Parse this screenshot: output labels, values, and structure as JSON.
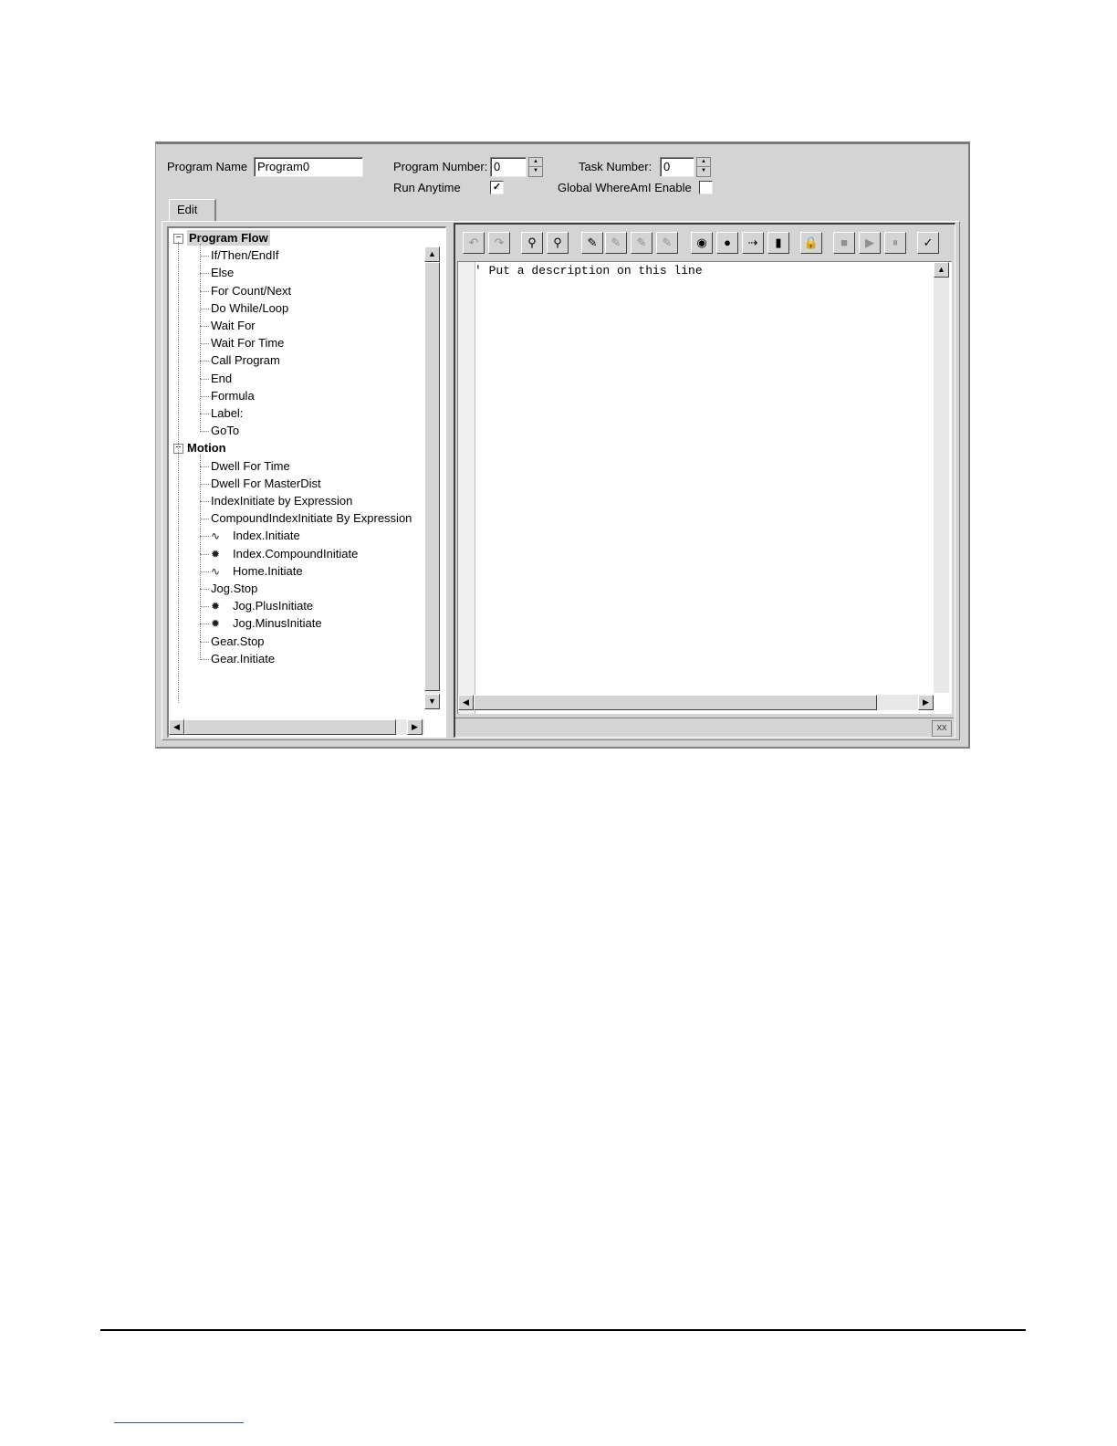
{
  "header": {
    "program_name_label": "Program Name",
    "program_name_value": "Program0",
    "program_number_label": "Program Number:",
    "program_number_value": "0",
    "task_number_label": "Task Number:",
    "task_number_value": "0",
    "run_anytime_label": "Run Anytime",
    "run_anytime_checked": true,
    "global_whereami_label": "Global WhereAmI Enable",
    "global_whereami_checked": false
  },
  "tabs": {
    "edit_label": "Edit"
  },
  "tree": {
    "groups": [
      {
        "label": "Program Flow",
        "expander": "⊟",
        "items": [
          "If/Then/EndIf",
          "Else",
          "For Count/Next",
          "Do While/Loop",
          "Wait For",
          "Wait For Time",
          "Call Program",
          "End",
          "Formula",
          "Label:",
          "GoTo"
        ]
      },
      {
        "label": "Motion",
        "expander": "⊟",
        "items": [
          "Dwell For Time",
          "Dwell For MasterDist",
          "IndexInitiate by Expression",
          "CompoundIndexInitiate By Expression",
          "Index.Initiate",
          "Index.CompoundInitiate",
          "Home.Initiate",
          "Jog.Stop",
          "Jog.PlusInitiate",
          "Jog.MinusInitiate",
          "Gear.Stop",
          "Gear.Initiate"
        ]
      }
    ],
    "item_icons": {
      "Index.Initiate": "∿",
      "Index.CompoundInitiate": "✹",
      "Home.Initiate": "∿",
      "Jog.PlusInitiate": "✹",
      "Jog.MinusInitiate": "✹"
    }
  },
  "toolbar": {
    "buttons": [
      {
        "name": "undo-icon",
        "glyph": "↶",
        "disabled": true
      },
      {
        "name": "redo-icon",
        "glyph": "↷",
        "disabled": true
      },
      {
        "name": "find-icon",
        "glyph": "⚲",
        "disabled": false
      },
      {
        "name": "find-replace-icon",
        "glyph": "⚲",
        "disabled": false
      },
      {
        "name": "toggle-bookmark-icon",
        "glyph": "✎",
        "disabled": false
      },
      {
        "name": "next-bookmark-icon",
        "glyph": "✎",
        "disabled": true
      },
      {
        "name": "prev-bookmark-icon",
        "glyph": "✎",
        "disabled": true
      },
      {
        "name": "clear-bookmarks-icon",
        "glyph": "✎",
        "disabled": true
      },
      {
        "name": "watch-icon",
        "glyph": "◉",
        "disabled": false
      },
      {
        "name": "breakpoint-icon",
        "glyph": "●",
        "disabled": false
      },
      {
        "name": "step-icon",
        "glyph": "⇢",
        "disabled": false
      },
      {
        "name": "run-icon",
        "glyph": "▮",
        "disabled": false
      },
      {
        "name": "lock-icon",
        "glyph": "🔒",
        "disabled": true
      },
      {
        "name": "stop-icon",
        "glyph": "■",
        "disabled": true
      },
      {
        "name": "play-icon",
        "glyph": "▶",
        "disabled": true
      },
      {
        "name": "pause-icon",
        "glyph": "⏸",
        "disabled": true
      },
      {
        "name": "check-syntax-icon",
        "glyph": "✓",
        "disabled": false
      }
    ]
  },
  "editor": {
    "line1": "' Put a description on this line",
    "status_indicator": "xx"
  }
}
